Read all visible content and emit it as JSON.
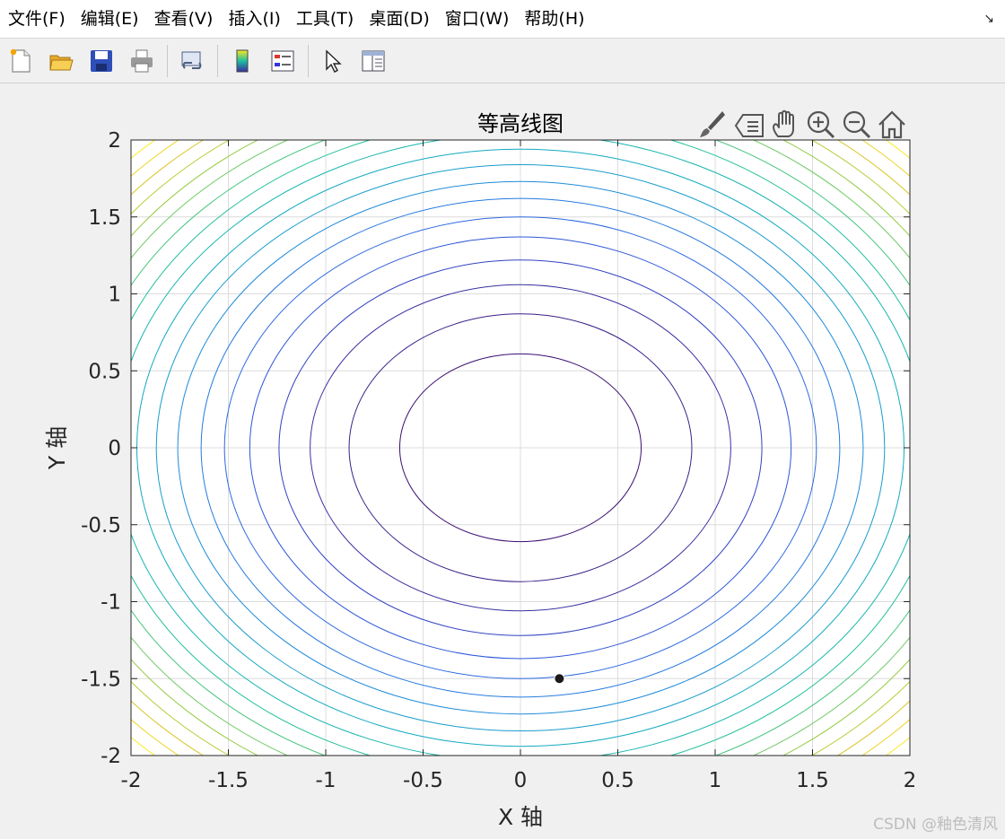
{
  "menu": {
    "items": [
      "文件(F)",
      "编辑(E)",
      "查看(V)",
      "插入(I)",
      "工具(T)",
      "桌面(D)",
      "窗口(W)",
      "帮助(H)"
    ],
    "corner_glyph": "↘"
  },
  "toolbar": {
    "buttons": [
      "new-file-icon",
      "open-folder-icon",
      "save-icon",
      "print-icon",
      "link-plot-icon",
      "colorbar-icon",
      "legend-icon",
      "pointer-icon",
      "property-inspector-icon"
    ]
  },
  "axes_toolbar": {
    "buttons": [
      "brush-icon",
      "data-tips-icon",
      "pan-hand-icon",
      "zoom-in-icon",
      "zoom-out-icon",
      "home-icon"
    ]
  },
  "chart_data": {
    "type": "contour",
    "title": "等高线图",
    "xlabel": "X 轴",
    "ylabel": "Y 轴",
    "xlim": [
      -2,
      2
    ],
    "ylim": [
      -2,
      2
    ],
    "xticks": [
      -2,
      -1.5,
      -1,
      -0.5,
      0,
      0.5,
      1,
      1.5,
      2
    ],
    "yticks": [
      -2,
      -1.5,
      -1,
      -0.5,
      0,
      0.5,
      1,
      1.5,
      2
    ],
    "xtick_labels": [
      "-2",
      "-1.5",
      "-1",
      "-0.5",
      "0",
      "0.5",
      "1",
      "1.5",
      "2"
    ],
    "ytick_labels": [
      "-2",
      "-1.5",
      "-1",
      "-0.5",
      "0",
      "0.5",
      "1",
      "1.5",
      "2"
    ],
    "grid": true,
    "levels_semi_axis_x": [
      0.62,
      0.88,
      1.08,
      1.24,
      1.39,
      1.52,
      1.64,
      1.76,
      1.87,
      1.97,
      2.08,
      2.17,
      2.27,
      2.36,
      2.44,
      2.53,
      2.61,
      2.69,
      2.77
    ],
    "levels_semi_axis_y": [
      0.61,
      0.87,
      1.06,
      1.22,
      1.37,
      1.5,
      1.62,
      1.73,
      1.84,
      1.94,
      2.04,
      2.14,
      2.23,
      2.32,
      2.4,
      2.48,
      2.56,
      2.64,
      2.72
    ],
    "colormap": [
      "#3b0f70",
      "#3a2c9b",
      "#2e4fd4",
      "#2a6fe3",
      "#1e90d8",
      "#12aac0",
      "#1cbfa0",
      "#5cc86d",
      "#a8cc3a",
      "#e0c52a",
      "#f9e821"
    ],
    "marker": {
      "x": 0.2,
      "y": -1.5,
      "color": "#1a1a1a"
    }
  },
  "watermark": "CSDN @釉色清风"
}
